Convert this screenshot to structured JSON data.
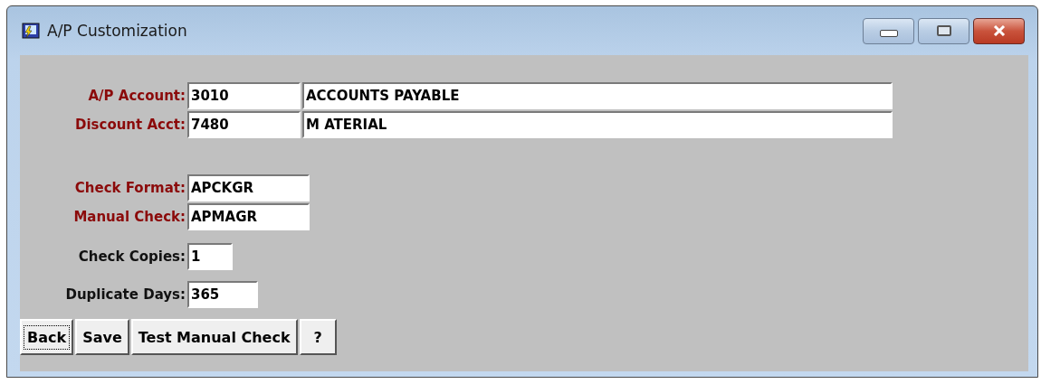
{
  "window": {
    "title": "A/P Customization"
  },
  "groups": [
    {
      "fields": [
        {
          "label": "A/P Account:",
          "required": true,
          "value": "3010",
          "description": "ACCOUNTS PAYABLE"
        },
        {
          "label": "Discount Acct:",
          "required": true,
          "value": "7480",
          "description": "M ATERIAL"
        }
      ]
    },
    {
      "fields": [
        {
          "label": "Check Format:",
          "required": true,
          "value": "APCKGR"
        },
        {
          "label": "Manual Check:",
          "required": true,
          "value": "APMAGR"
        }
      ]
    },
    {
      "fields": [
        {
          "label": "Check Copies:",
          "required": false,
          "value": "1"
        }
      ]
    },
    {
      "fields": [
        {
          "label": "Duplicate Days:",
          "required": false,
          "value": "365"
        }
      ]
    }
  ],
  "buttons": [
    {
      "label": "Back",
      "focused": true
    },
    {
      "label": "Save",
      "focused": false
    },
    {
      "label": "Test Manual Check",
      "focused": false
    },
    {
      "label": "?",
      "focused": false
    }
  ]
}
